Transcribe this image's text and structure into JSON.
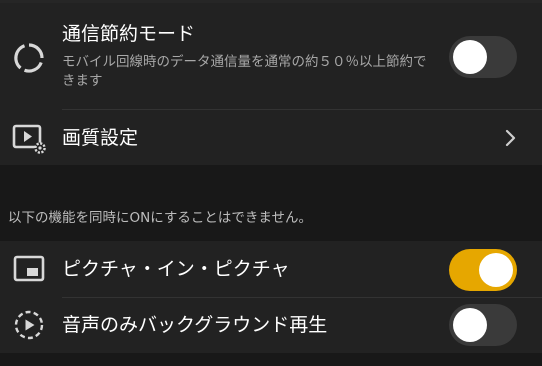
{
  "settings": {
    "data_saver": {
      "title": "通信節約モード",
      "description": "モバイル回線時のデータ通信量を通常の約５０％以上節約できます",
      "enabled": false,
      "icon": "data-saver-icon"
    },
    "quality": {
      "title": "画質設定",
      "icon": "video-settings-icon",
      "chevron": "chevron-right-icon"
    }
  },
  "section_note": "以下の機能を同時にONにすることはできません。",
  "playback": {
    "pip": {
      "title": "ピクチャ・イン・ピクチャ",
      "enabled": true,
      "icon": "picture-in-picture-icon"
    },
    "background_audio": {
      "title": "音声のみバックグラウンド再生",
      "enabled": false,
      "icon": "background-play-icon"
    }
  },
  "colors": {
    "toggle_on": "#e6a700",
    "toggle_off": "#3a3a3a",
    "background": "#181818",
    "card": "#222222"
  }
}
